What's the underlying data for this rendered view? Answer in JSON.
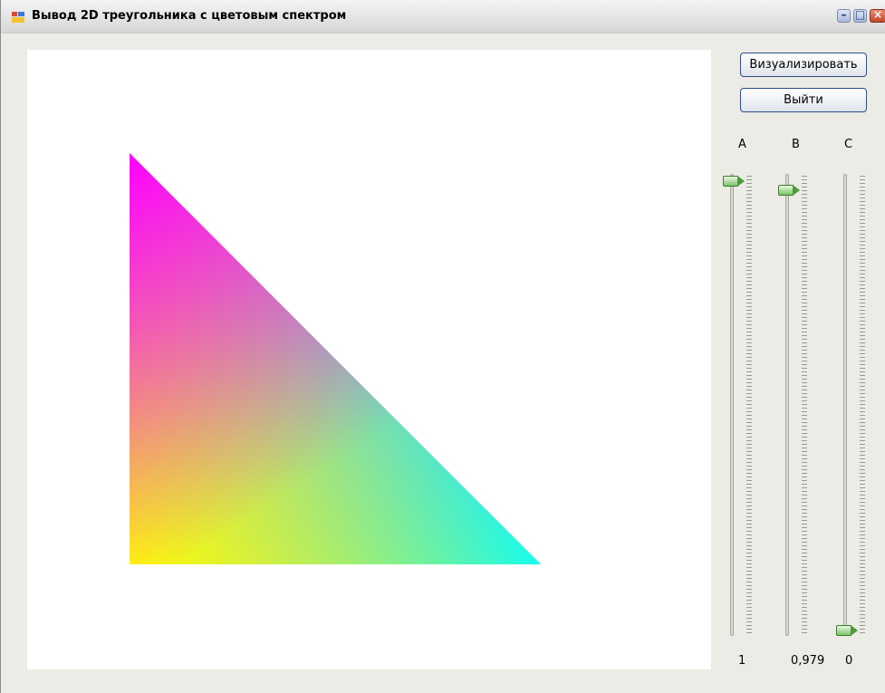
{
  "window": {
    "title": "Вывод 2D треугольника с цветовым спектром"
  },
  "controls": {
    "render_label": "Визуализировать",
    "exit_label": "Выйти"
  },
  "sliders": [
    {
      "label": "A",
      "value": 1,
      "value_text": "1"
    },
    {
      "label": "B",
      "value": 0.979,
      "value_text": "0,979"
    },
    {
      "label": "C",
      "value": 0,
      "value_text": "0"
    }
  ],
  "triangle": {
    "vertex_colors": {
      "top": "#ff00ff",
      "bottom_left": "#ffff00",
      "bottom_right": "#00ffff"
    }
  }
}
